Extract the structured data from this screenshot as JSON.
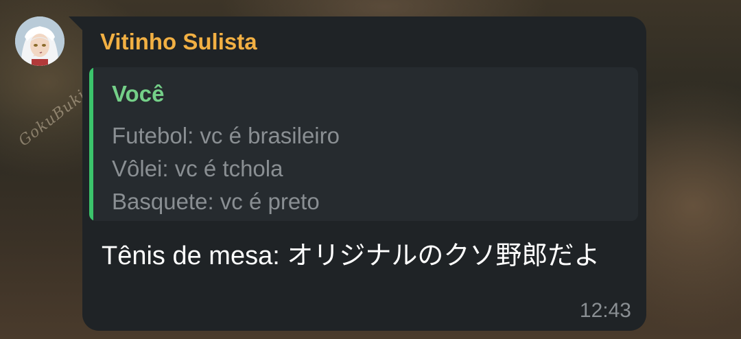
{
  "wallpaper": {
    "watermark": "GokuBuki"
  },
  "message": {
    "sender_name": "Vitinho Sulista",
    "sender_color": "#f2b043",
    "reply": {
      "author": "Você",
      "author_color": "#74cf88",
      "bar_color": "#3bc46b",
      "lines": [
        "Futebol: vc é brasileiro",
        "Vôlei: vc é tchola",
        "Basquete: vc é preto"
      ]
    },
    "text": "Tênis de mesa: オリジナルのクソ野郎だよ",
    "time": "12:43"
  },
  "colors": {
    "bubble": "#1f2326",
    "reply_background": "#262b2f",
    "text": "#ffffff",
    "muted": "#8a8f93"
  }
}
